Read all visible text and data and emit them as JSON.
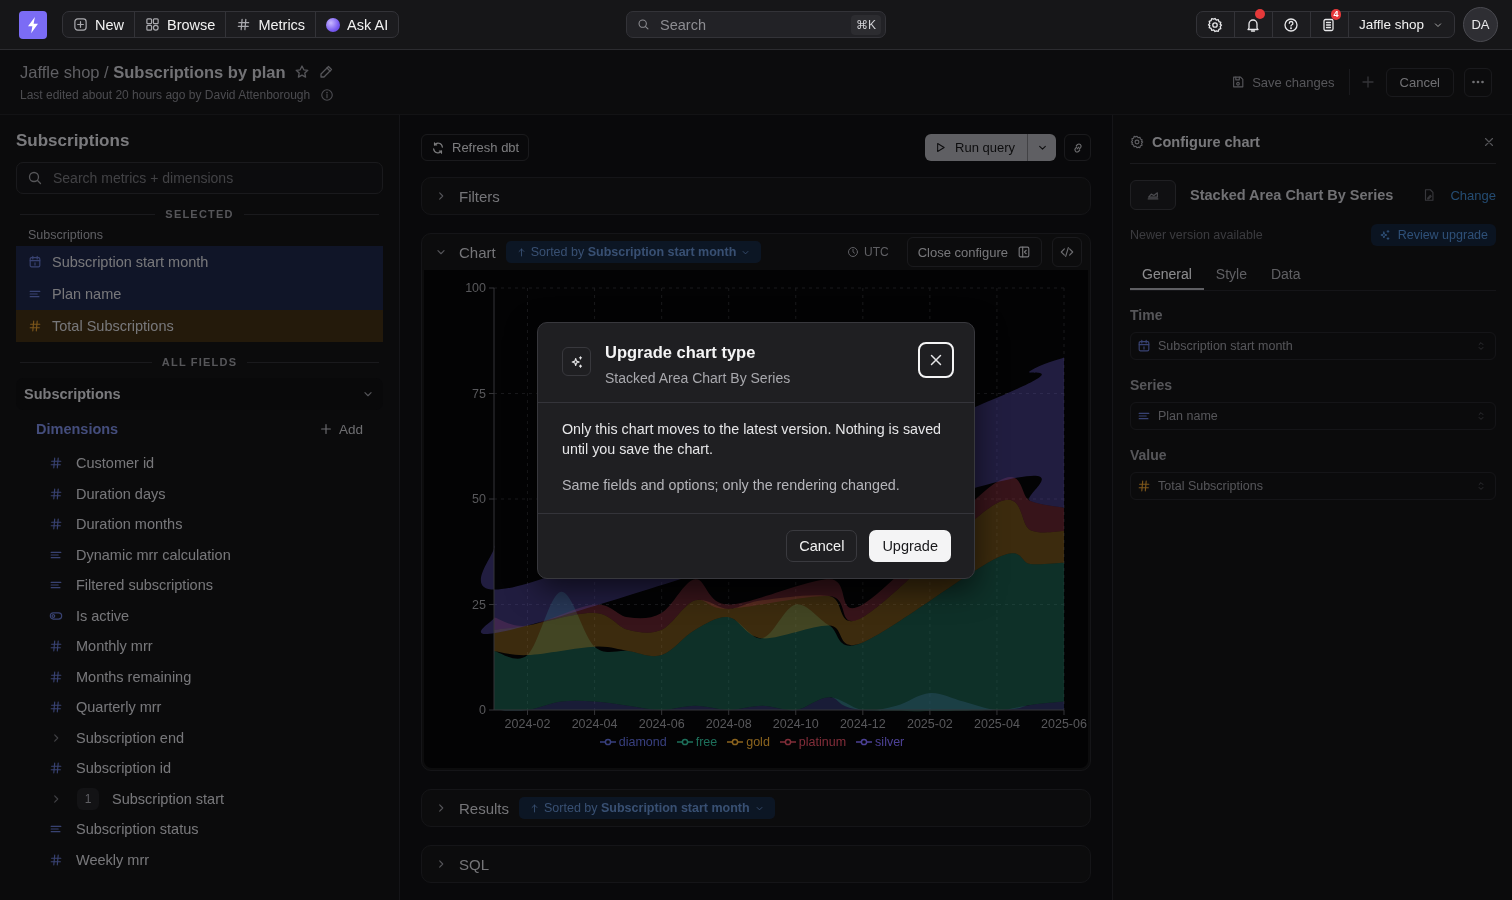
{
  "top_bar": {
    "nav": [
      {
        "kind": "new",
        "label": "New"
      },
      {
        "kind": "browse",
        "label": "Browse"
      },
      {
        "kind": "metrics",
        "label": "Metrics"
      },
      {
        "kind": "ask_ai",
        "label": "Ask AI"
      }
    ],
    "search": {
      "placeholder": "Search",
      "shortcut": "⌘K"
    },
    "notification_alert": true,
    "news_badge": "4",
    "workspace": "Jaffle shop",
    "avatar": "DA"
  },
  "header": {
    "title": "Jaffle shop / **Subscriptions by plan**",
    "starred": false,
    "last_edited": "Last edited about 20 hours ago by David Attenborough",
    "save": {
      "label": "Save changes",
      "disabled": true
    },
    "cancel": "Cancel"
  },
  "sidebar": {
    "title": "Subscriptions",
    "search_placeholder": "Search metrics + dimensions",
    "selected_heading": "SELECTED",
    "selected_group": "Subscriptions",
    "selected": [
      {
        "label": "Subscription start month",
        "kind": "date"
      },
      {
        "label": "Plan name",
        "kind": "string"
      },
      {
        "label": "Total Subscriptions",
        "kind": "metric"
      }
    ],
    "all_heading": "ALL FIELDS",
    "table": {
      "label": "Subscriptions",
      "expanded": true
    },
    "dimensions_heading": "Dimensions",
    "add_label": "Add",
    "fields": [
      {
        "label": "Customer id",
        "kind": "number"
      },
      {
        "label": "Duration days",
        "kind": "number"
      },
      {
        "label": "Duration months",
        "kind": "number"
      },
      {
        "label": "Dynamic mrr calculation",
        "kind": "string"
      },
      {
        "label": "Filtered subscriptions",
        "kind": "string"
      },
      {
        "label": "Is active",
        "kind": "boolean"
      },
      {
        "label": "Monthly mrr",
        "kind": "number"
      },
      {
        "label": "Months remaining",
        "kind": "number"
      },
      {
        "label": "Quarterly mrr",
        "kind": "number"
      },
      {
        "label": "Subscription end",
        "kind": "group",
        "expanded": false
      },
      {
        "label": "Subscription id",
        "kind": "number"
      },
      {
        "label": "Subscription start",
        "kind": "group",
        "expanded": false,
        "count": "1"
      },
      {
        "label": "Subscription status",
        "kind": "string"
      },
      {
        "label": "Weekly mrr",
        "kind": "number"
      }
    ]
  },
  "explorer": {
    "refresh": "Refresh dbt",
    "run": "Run query",
    "filters": {
      "label": "Filters",
      "expanded": false
    },
    "chart_card": {
      "label": "Chart",
      "expanded": true,
      "sort": "Sorted by **Subscription start month**",
      "timezone": "UTC",
      "close_configure": "Close configure",
      "chart_data": {
        "type": "area",
        "stacked": true,
        "grid": true,
        "legend": "bottom",
        "categories": [
          null,
          "2024-02",
          null,
          "2024-04",
          null,
          "2024-06",
          null,
          "2024-08",
          null,
          "2024-10",
          null,
          "2024-12",
          null,
          "2025-02",
          null,
          "2025-04",
          null,
          "2025-06"
        ],
        "series": [
          {
            "name": "diamond",
            "color": "#5a66cc",
            "values": [
              0,
              0,
              2,
              2,
              1,
              0,
              1,
              0,
              1,
              0,
              3,
              0,
              1,
              4,
              2,
              0,
              1.2,
              2.0
            ]
          },
          {
            "name": "free",
            "color": "#2fb392",
            "values": [
              14,
              13,
              26,
              13,
              13,
              13,
              18,
              22,
              16,
              25,
              17,
              16,
              null,
              null,
              null,
              36,
              33.4,
              32.9
            ]
          },
          {
            "name": "gold",
            "color": "#e0a030",
            "values": [
              5,
              7,
              null,
              8,
              5,
              6,
              7,
              2,
              9,
              null,
              7,
              6,
              null,
              null,
              null,
              13,
              8.0,
              7.5
            ]
          },
          {
            "name": "platinum",
            "color": "#d0485c",
            "values": [
              3,
              0,
              null,
              2,
              3,
              4,
              5,
              1,
              null,
              null,
              4,
              3,
              null,
              null,
              null,
              5,
              6.9,
              5.5
            ]
          },
          {
            "name": "silver",
            "color": "#7a68f0",
            "values": [
              17,
              10,
              null,
              null,
              null,
              null,
              null,
              null,
              null,
              null,
              null,
              null,
              null,
              null,
              null,
              20,
              30.9,
              35.6
            ]
          }
        ],
        "ylim": [
          0,
          100
        ],
        "yticks": [
          0,
          25,
          50,
          75,
          100
        ]
      }
    },
    "results": {
      "label": "Results",
      "expanded": false,
      "sort": "Sorted by **Subscription start month**"
    },
    "sql": {
      "label": "SQL",
      "expanded": false
    }
  },
  "config_panel": {
    "title": "Configure chart",
    "chart_type": "Stacked Area Chart By Series",
    "change": "Change",
    "notice": "Newer version available",
    "review": "Review upgrade",
    "tabs": [
      {
        "label": "General",
        "selected": true
      },
      {
        "label": "Style",
        "selected": false
      },
      {
        "label": "Data",
        "selected": false
      }
    ],
    "fields": [
      {
        "label": "Time",
        "value": "Subscription start month",
        "kind": "date"
      },
      {
        "label": "Series",
        "value": "Plan name",
        "kind": "string"
      },
      {
        "label": "Value",
        "value": "Total Subscriptions",
        "kind": "metric"
      }
    ]
  },
  "dialog": {
    "title": "Upgrade chart type",
    "subtitle": "Stacked Area Chart By Series",
    "paragraphs": [
      "Only this chart moves to the latest version. Nothing is saved until you save the chart.",
      "Same fields and options; only the rendering changed."
    ],
    "cancel": "Cancel",
    "confirm": "Upgrade"
  }
}
